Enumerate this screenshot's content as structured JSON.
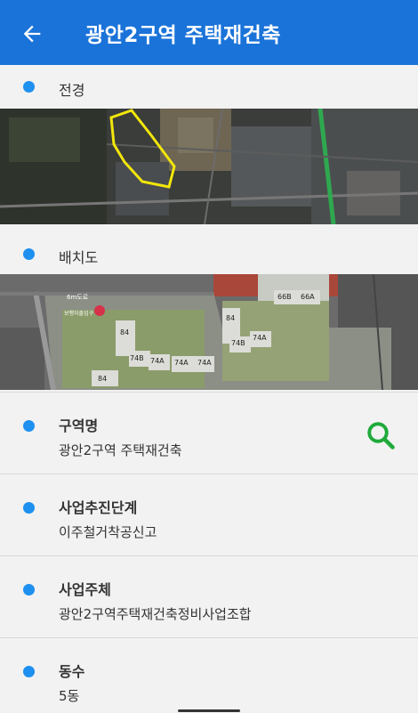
{
  "appbar": {
    "title": "광안2구역 주택재건축",
    "back_icon": "arrow-left-icon"
  },
  "sections": {
    "overview": {
      "label": "전경"
    },
    "layout": {
      "label": "배치도"
    }
  },
  "layout_map_labels": {
    "road": "6m도로",
    "entrance": "보행자출입구",
    "buildings": [
      "84",
      "74B",
      "74A",
      "74A",
      "74A",
      "84",
      "74B",
      "74A",
      "66B",
      "66A",
      "84"
    ]
  },
  "fields": [
    {
      "label": "구역명",
      "value": "광안2구역 주택재건축",
      "has_search": true
    },
    {
      "label": "사업추진단계",
      "value": "이주철거착공신고"
    },
    {
      "label": "사업주체",
      "value": "광안2구역주택재건축정비사업조합"
    },
    {
      "label": "동수",
      "value": "5동"
    }
  ],
  "colors": {
    "appbar": "#1a73d9",
    "dot": "#1e90f0",
    "search_icon": "#1faa3a",
    "boundary": "#f2e60b"
  }
}
